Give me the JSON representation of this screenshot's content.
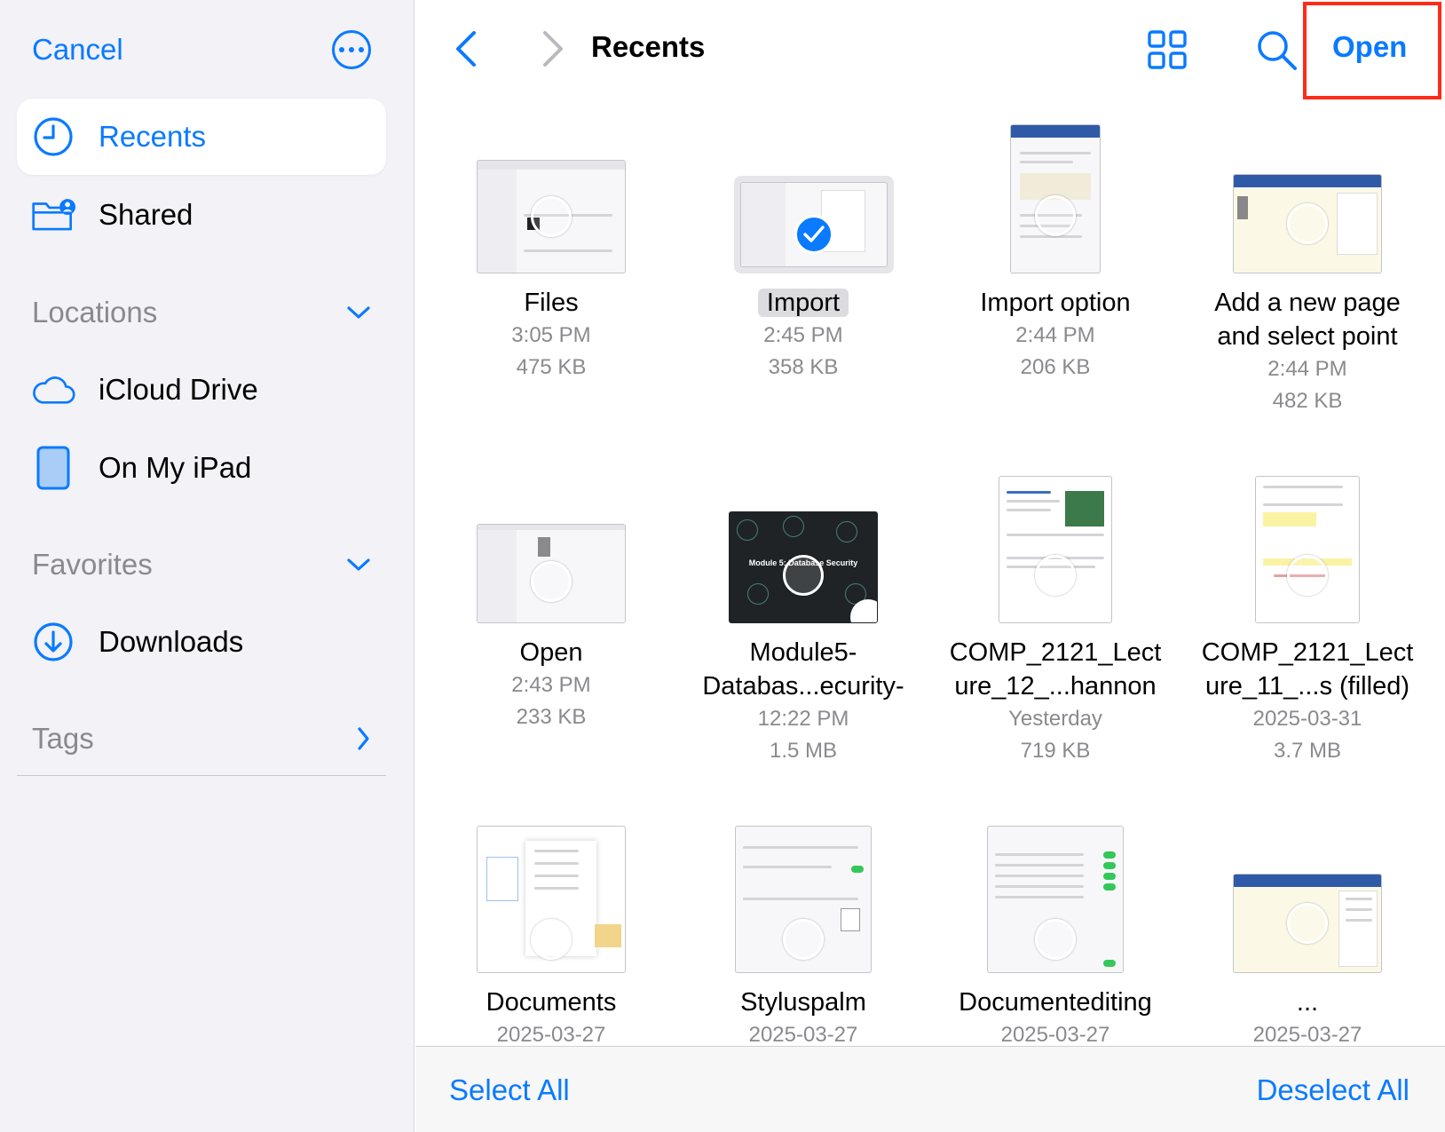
{
  "colors": {
    "accent": "#0a7aff",
    "highlight": "#ff2a1a",
    "secondary_text": "#8a8a8e"
  },
  "sidebar": {
    "cancel_label": "Cancel",
    "more_icon": "ellipsis-circle-icon",
    "recents": {
      "label": "Recents",
      "icon": "clock-icon"
    },
    "shared": {
      "label": "Shared",
      "icon": "shared-folder-icon"
    },
    "locations": {
      "label": "Locations",
      "items": [
        {
          "label": "iCloud Drive",
          "icon": "cloud-icon"
        },
        {
          "label": "On My iPad",
          "icon": "ipad-icon"
        }
      ]
    },
    "favorites": {
      "label": "Favorites",
      "items": [
        {
          "label": "Downloads",
          "icon": "download-circle-icon"
        }
      ]
    },
    "tags": {
      "label": "Tags"
    }
  },
  "header": {
    "title": "Recents",
    "open_label": "Open"
  },
  "files": [
    {
      "name": "Files",
      "time": "3:05 PM",
      "size": "475 KB"
    },
    {
      "name": "Import",
      "time": "2:45 PM",
      "size": "358 KB",
      "selected": true
    },
    {
      "name": "Import option",
      "time": "2:44 PM",
      "size": "206 KB"
    },
    {
      "name": "Add a new page",
      "name2": "and select point",
      "time": "2:44 PM",
      "size": "482 KB"
    },
    {
      "name": "Open",
      "time": "2:43 PM",
      "size": "233 KB"
    },
    {
      "name": "Module5-",
      "name2": "Databas...ecurity-",
      "time": "12:22 PM",
      "size": "1.5 MB",
      "thumb_title": "Module 5: Database Security"
    },
    {
      "name": "COMP_2121_Lect",
      "name2": "ure_12_...hannon",
      "time": "Yesterday",
      "size": "719 KB"
    },
    {
      "name": "COMP_2121_Lect",
      "name2": "ure_11_...s (filled)",
      "time": "2025-03-31",
      "size": "3.7 MB"
    },
    {
      "name": "Documents",
      "time": "2025-03-27"
    },
    {
      "name": "Styluspalm",
      "time": "2025-03-27"
    },
    {
      "name": "Documentediting",
      "time": "2025-03-27"
    },
    {
      "name": "...",
      "time": "2025-03-27"
    }
  ],
  "footer": {
    "select_all_label": "Select All",
    "deselect_all_label": "Deselect All"
  }
}
